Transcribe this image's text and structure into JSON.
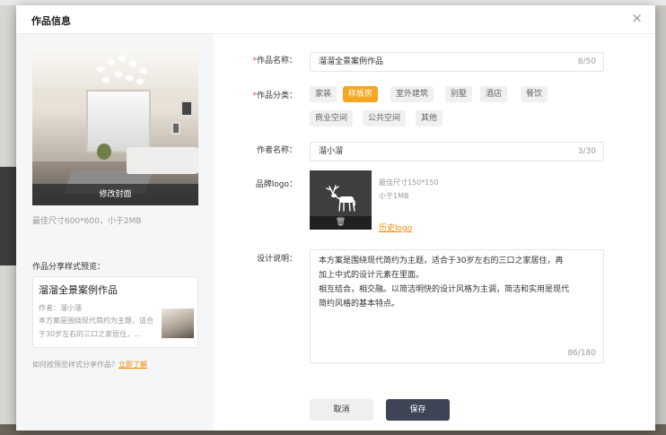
{
  "modal": {
    "title": "作品信息",
    "close": "×"
  },
  "left": {
    "cover_edit_label": "修改封面",
    "cover_hint": "最佳尺寸600*600，小于2MB",
    "share_preview_title": "作品分享样式预览：",
    "share_card": {
      "title": "溜溜全景案例作品",
      "author": "作者：溜小溜",
      "desc": "本方案是围绕现代简约为主题，适合于30岁左右的三口之家居住，..."
    },
    "share_help_text": "如何按预览样式分享作品？",
    "share_help_link": "立即了解"
  },
  "form": {
    "name": {
      "required_mark": "*",
      "label": "作品名称：",
      "value": "溜溜全景案例作品",
      "count": "8/50"
    },
    "category": {
      "required_mark": "*",
      "label": "作品分类：",
      "options": [
        "家装",
        "样板房",
        "室外建筑",
        "别墅",
        "酒店",
        "餐饮",
        "商业空间",
        "公共空间",
        "其他"
      ],
      "selected": "样板房"
    },
    "author": {
      "label": "作者名称：",
      "value": "溜小溜",
      "count": "3/30"
    },
    "logo": {
      "label": "品牌logo：",
      "trash_icon": "🗑",
      "hint_size": "最佳尺寸150*150",
      "hint_limit": "小于1MB",
      "history_link": "历史logo"
    },
    "description": {
      "label": "设计说明：",
      "value_line1": "本方案是围绕现代简约为主题，适合于30岁左右的三口之家居住，再",
      "value_line2": "加上中式的设计元素在里面。",
      "value_line3": "相互结合，相交融。以简洁明快的设计风格为主调，简洁和实用是现代",
      "value_line4": "简约风格的基本特点。",
      "count": "86/180"
    },
    "cancel_label": "取消",
    "save_label": "保存"
  },
  "colors": {
    "accent": "#f5a623",
    "link": "#f08a00",
    "primary_button": "#3d4456",
    "required": "#f03e3e"
  }
}
